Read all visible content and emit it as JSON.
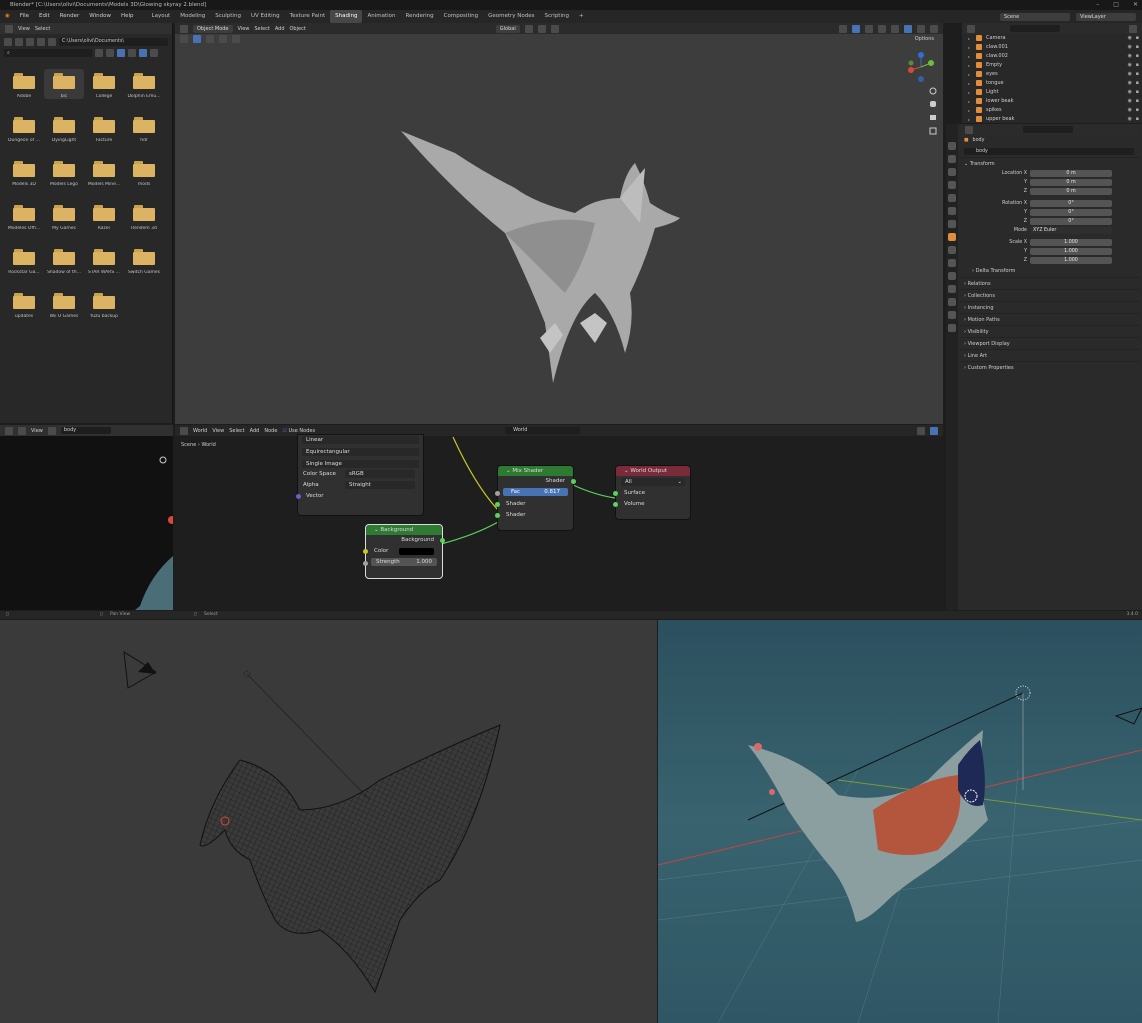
{
  "window": {
    "title": "Blender* [C:\\Users\\olivi\\Documents\\Models 3D\\Glowing skyray 2.blend]"
  },
  "menu": [
    "File",
    "Edit",
    "Render",
    "Window",
    "Help"
  ],
  "workspaces": [
    "Layout",
    "Modeling",
    "Sculpting",
    "UV Editing",
    "Texture Paint",
    "Shading",
    "Animation",
    "Rendering",
    "Compositing",
    "Geometry Nodes",
    "Scripting"
  ],
  "active_workspace": "Shading",
  "top_right": {
    "scene": "Scene",
    "view_layer": "ViewLayer"
  },
  "file_browser": {
    "menu": [
      "View",
      "Select"
    ],
    "path": "C:\\Users\\olivi\\Documents\\",
    "folders": [
      "Adobe",
      "bic",
      "College",
      "Dolphin Emu...",
      "Dungeon of ...",
      "DyingLight",
      "Facture",
      "hdr",
      "Models 3D",
      "Models Lego",
      "Models Mine...",
      "mods",
      "Modèles Offi...",
      "My Games",
      "Razer",
      "Rendem 3d",
      "Rockstar Ga...",
      "Shadow of th...",
      "STAR WARS ...",
      "Switch Games",
      "updates",
      "Wii U Games",
      "Yuzu backup"
    ],
    "selected": "bic"
  },
  "viewport": {
    "mode": "Object Mode",
    "menu": [
      "View",
      "Select",
      "Add",
      "Object"
    ],
    "transform": "Global",
    "options": "Options"
  },
  "outliner": {
    "items": [
      "Camera",
      "claw.001",
      "claw.002",
      "Empty",
      "eyes",
      "tongue",
      "Light",
      "lower beak",
      "spikes",
      "upper beak"
    ]
  },
  "properties": {
    "object": "body",
    "datablock": "body",
    "transform_title": "Transform",
    "location": {
      "label_x": "Location X",
      "x": "0 m",
      "y": "0 m",
      "z": "0 m"
    },
    "rotation": {
      "label_x": "Rotation X",
      "x": "0°",
      "y": "0°",
      "z": "0°"
    },
    "mode": {
      "label": "Mode",
      "value": "XYZ Euler"
    },
    "scale": {
      "label_x": "Scale X",
      "x": "1.000",
      "y": "1.000",
      "z": "1.000"
    },
    "axis_labels": {
      "y": "Y",
      "z": "Z"
    },
    "delta": "Delta Transform",
    "sections": [
      "Relations",
      "Collections",
      "Instancing",
      "Motion Paths",
      "Visibility",
      "Viewport Display",
      "Line Art",
      "Custom Properties"
    ]
  },
  "left_bottom": {
    "menu": "View",
    "name": "body"
  },
  "node_editor": {
    "type": "World",
    "menu": [
      "View",
      "Select",
      "Add",
      "Node"
    ],
    "use_nodes": "Use Nodes",
    "world": "World",
    "breadcrumb": [
      "Scene",
      "World"
    ],
    "image_node": {
      "interp": "Linear",
      "proj": "Equirectangular",
      "src": "Single Image",
      "cs_label": "Color Space",
      "cs": "sRGB",
      "alpha_label": "Alpha",
      "alpha": "Straight",
      "vector": "Vector"
    },
    "background_node": {
      "title": "Background",
      "out": "Background",
      "color": "Color",
      "strength_label": "Strength",
      "strength": "1.000"
    },
    "mix_node": {
      "title": "Mix Shader",
      "out": "Shader",
      "fac_label": "Fac",
      "fac": "0.817",
      "in1": "Shader",
      "in2": "Shader"
    },
    "output_node": {
      "title": "World Output",
      "target": "All",
      "surface": "Surface",
      "volume": "Volume"
    }
  },
  "statusbar": {
    "pan": "Pan View",
    "select": "Select",
    "version": "3.4.0"
  },
  "colors": {
    "accent": "#4772b3",
    "folder": "#dcb362",
    "shader_node": "#2f7a33",
    "output_node": "#7a2a38"
  }
}
